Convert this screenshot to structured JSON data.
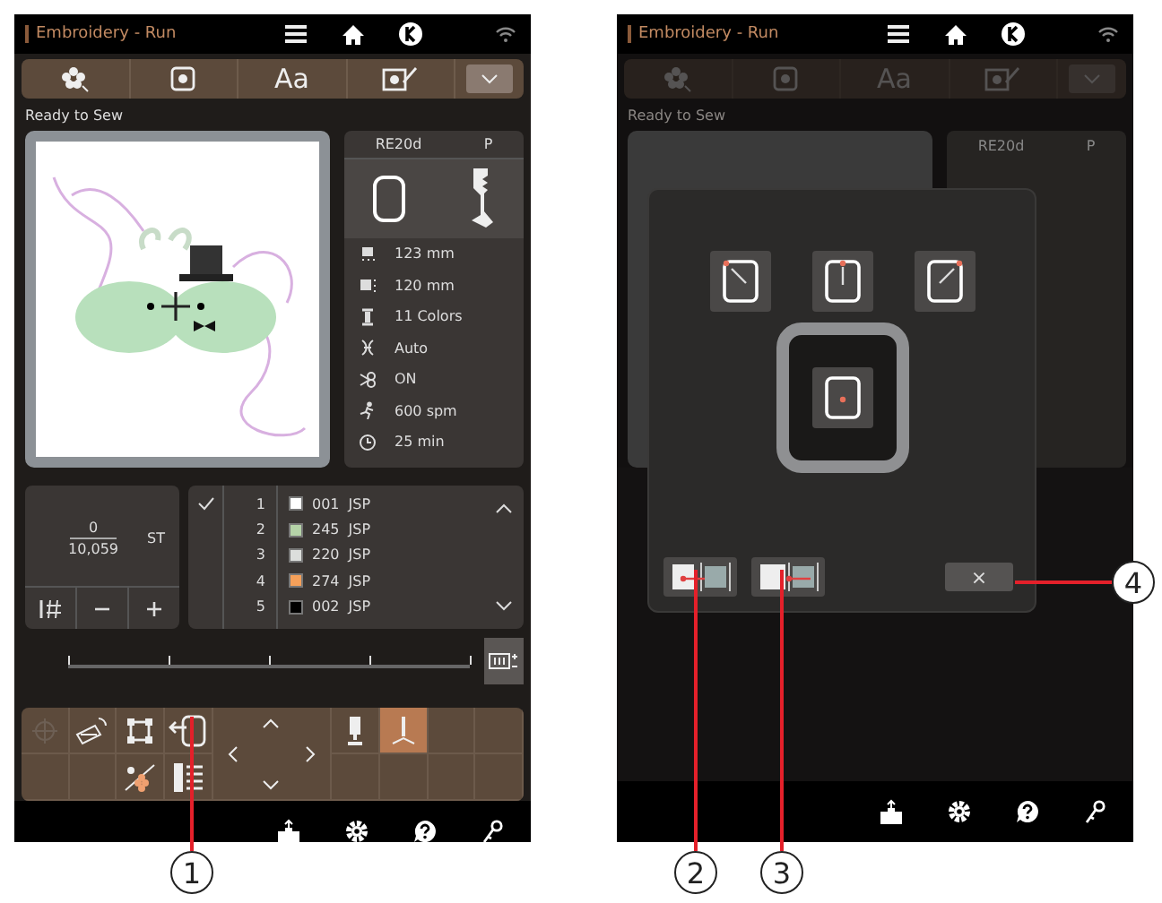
{
  "left_screen": {
    "title": "Embroidery - Run",
    "toolbar": {
      "text_tab": "Aa"
    },
    "status": "Ready to Sew",
    "hoop_panel": {
      "hoop": "RE20d",
      "foot": "P",
      "info": [
        {
          "kind": "height",
          "text": "123 mm"
        },
        {
          "kind": "width",
          "text": "120 mm"
        },
        {
          "kind": "colors",
          "text": "11 Colors"
        },
        {
          "kind": "tension",
          "text": "Auto"
        },
        {
          "kind": "cutter",
          "text": "ON"
        },
        {
          "kind": "speed",
          "text": "600 spm"
        },
        {
          "kind": "time",
          "text": "25 min"
        }
      ]
    },
    "stitch_counter": {
      "current": "0",
      "total": "10,059",
      "unit": "ST"
    },
    "color_list": [
      {
        "number": "1",
        "code": "001",
        "brand": "JSP",
        "color": "#ffffff"
      },
      {
        "number": "2",
        "code": "245",
        "brand": "JSP",
        "color": "#b5d3a8"
      },
      {
        "number": "3",
        "code": "220",
        "brand": "JSP",
        "color": "#dcdedc"
      },
      {
        "number": "4",
        "code": "274",
        "brand": "JSP",
        "color": "#f5a05a"
      },
      {
        "number": "5",
        "code": "002",
        "brand": "JSP",
        "color": "#000000"
      }
    ],
    "controls": [
      {
        "kind": "target",
        "disabled": true,
        "selected": false
      },
      {
        "kind": "rotate",
        "disabled": false,
        "selected": false
      },
      {
        "kind": "corners",
        "disabled": false,
        "selected": false
      },
      {
        "kind": "move",
        "disabled": false,
        "selected": false
      },
      {
        "kind": "arrows",
        "disabled": false,
        "selected": false
      },
      {
        "kind": "foot",
        "disabled": false,
        "selected": false
      },
      {
        "kind": "needle",
        "disabled": false,
        "selected": true
      },
      {
        "kind": "colorstar",
        "disabled": false,
        "selected": false
      },
      {
        "kind": "list",
        "disabled": false,
        "selected": false
      }
    ]
  },
  "right_screen": {
    "title": "Embroidery - Run",
    "toolbar": {
      "text_tab": "Aa"
    },
    "status": "Ready to Sew",
    "hoop": "RE20d",
    "foot": "P",
    "dialog": {
      "positions": [
        {
          "kind": "top-left",
          "selected": false
        },
        {
          "kind": "top",
          "selected": false
        },
        {
          "kind": "top-right",
          "selected": false
        },
        {
          "kind": "center",
          "selected": true
        }
      ],
      "park_buttons": [
        {
          "kind": "left"
        },
        {
          "kind": "center"
        }
      ],
      "close": "×"
    }
  },
  "callouts": [
    {
      "label": "1"
    },
    {
      "label": "2"
    },
    {
      "label": "3"
    },
    {
      "label": "4"
    }
  ]
}
